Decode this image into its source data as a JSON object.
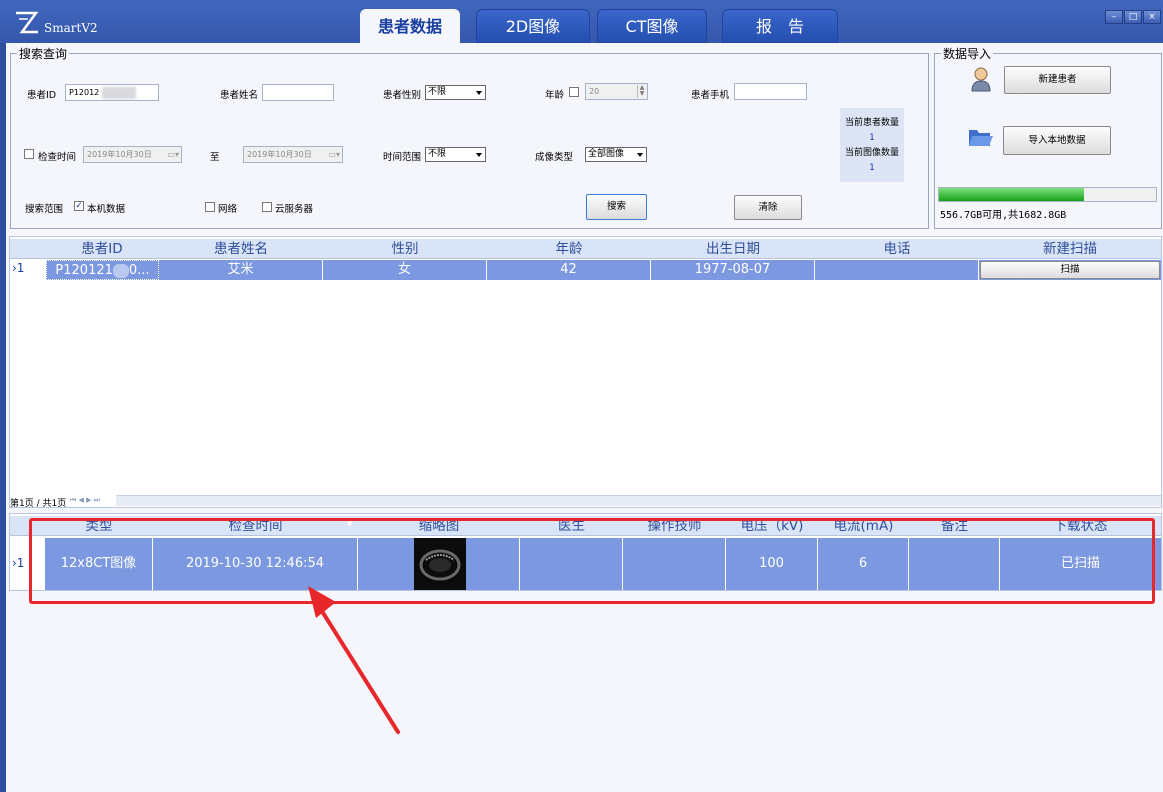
{
  "app": {
    "title": "SmartV2"
  },
  "tabs": [
    {
      "label": "患者数据",
      "active": true
    },
    {
      "label": "2D图像",
      "active": false
    },
    {
      "label": "CT图像",
      "active": false
    },
    {
      "label": "报　告",
      "active": false
    }
  ],
  "window": {
    "min": "–",
    "max": "□",
    "close": "×"
  },
  "search": {
    "legend": "搜索查询",
    "patient_id_label": "患者ID",
    "patient_id_value": "P12012",
    "patient_name_label": "患者姓名",
    "patient_name_value": "",
    "gender_label": "患者性别",
    "gender_value": "不限",
    "age_label": "年龄",
    "age_value": "20",
    "phone_label": "患者手机",
    "phone_value": "",
    "exam_time_label": "检查时间",
    "date_from": "2019年10月30日",
    "to_label": "至",
    "date_to": "2019年10月30日",
    "time_range_label": "时间范围",
    "time_range_value": "不限",
    "imaging_type_label": "成像类型",
    "imaging_type_value": "全部图像",
    "scope_label": "搜索范围",
    "scope_local": "本机数据",
    "scope_network": "网络",
    "scope_cloud": "云服务器",
    "search_button": "搜索",
    "clear_button": "清除",
    "patient_count_label": "当前患者数量",
    "patient_count": "1",
    "image_count_label": "当前图像数量",
    "image_count": "1"
  },
  "import": {
    "legend": "数据导入",
    "new_patient_button": "新建患者",
    "import_local_button": "导入本地数据",
    "storage_text": "556.7GB可用,共1682.8GB",
    "storage_used_fraction": 0.67
  },
  "patients": {
    "columns": [
      "患者ID",
      "患者姓名",
      "性别",
      "年龄",
      "出生日期",
      "电话",
      "新建扫描"
    ],
    "rows": [
      {
        "marker": "›1",
        "id": "P120121",
        "id_suffix": "0...",
        "name": "艾米",
        "gender": "女",
        "age": "42",
        "dob": "1977-08-07",
        "phone": "",
        "scan_button": "扫描"
      }
    ],
    "pager": "第1页 / 共1页"
  },
  "images": {
    "columns": [
      "类型",
      "检查时间",
      "缩略图",
      "医生",
      "操作技师",
      "电压（kV)",
      "电流(mA)",
      "备注",
      "下载状态"
    ],
    "rows": [
      {
        "marker": "›1",
        "type": "12x8CT图像",
        "time": "2019-10-30 12:46:54",
        "doctor": "",
        "technician": "",
        "voltage": "100",
        "current": "6",
        "note": "",
        "status": "已扫描"
      }
    ]
  },
  "colors": {
    "accent": "#e8272b",
    "row_selected": "#7c98e0",
    "header_text": "#2f4f9a"
  }
}
